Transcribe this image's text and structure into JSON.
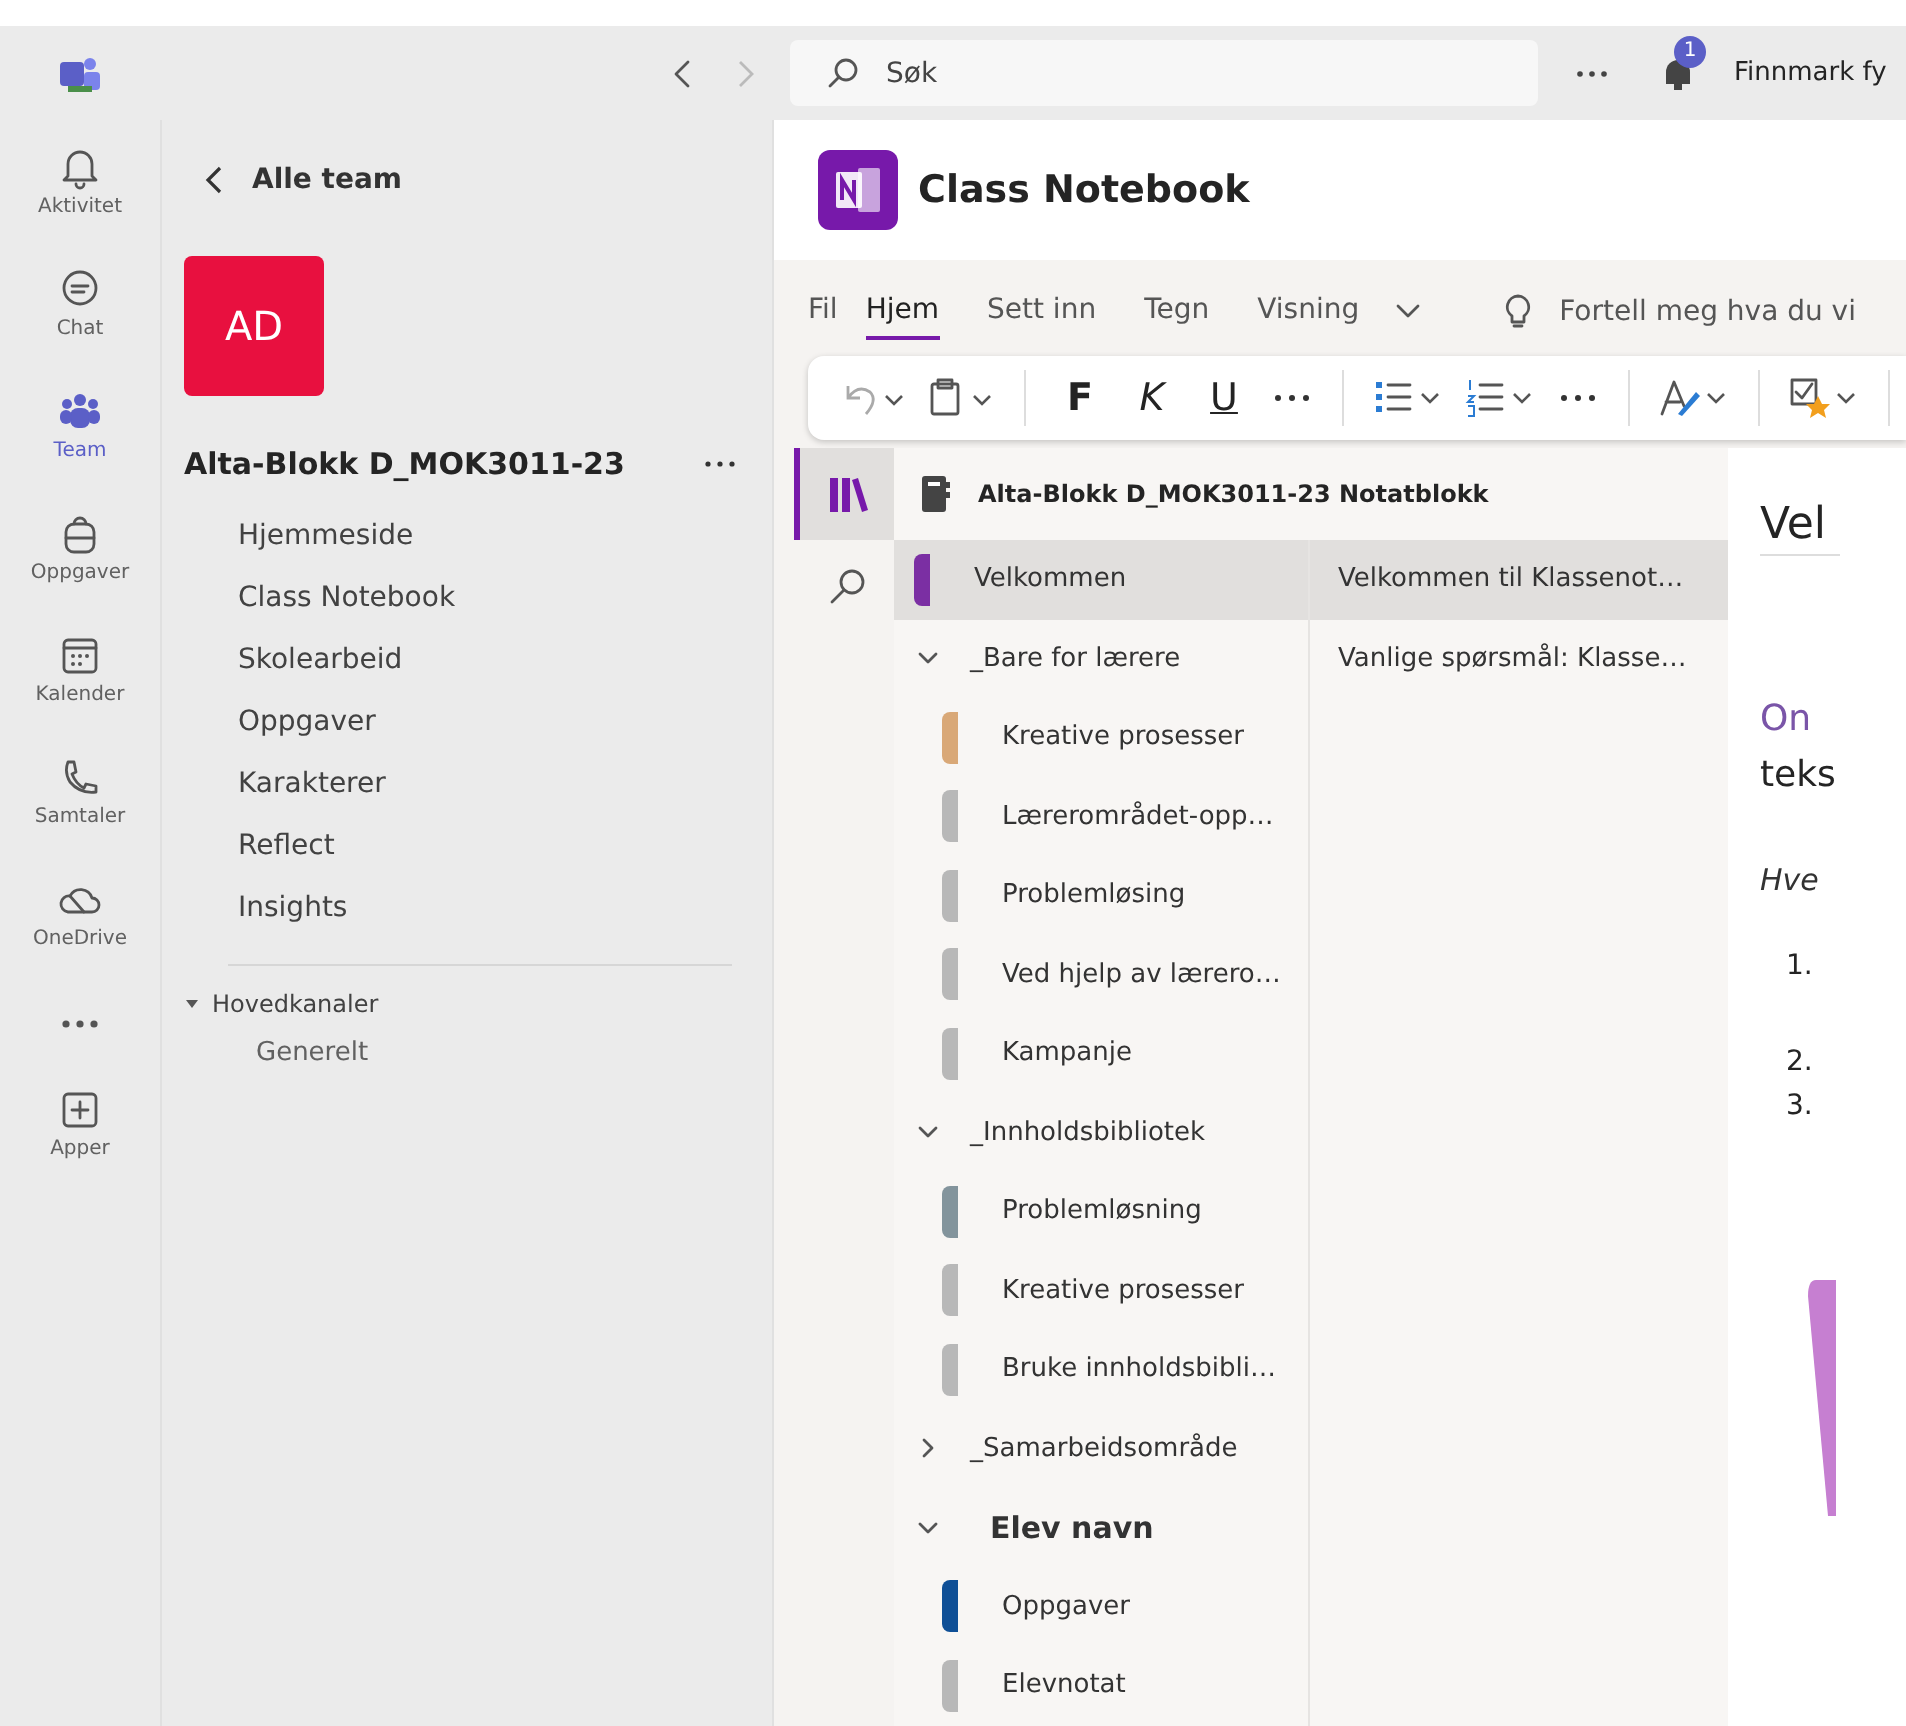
{
  "top_bar": {
    "search": {
      "placeholder": "Søk"
    },
    "notification_count": "1",
    "account": "Finnmark fy"
  },
  "rail": [
    {
      "kind": "bell",
      "label": "Aktivitet",
      "selected": false
    },
    {
      "kind": "chat",
      "label": "Chat",
      "selected": false
    },
    {
      "kind": "team",
      "label": "Team",
      "selected": true
    },
    {
      "kind": "bag",
      "label": "Oppgaver",
      "selected": false
    },
    {
      "kind": "calendar",
      "label": "Kalender",
      "selected": false
    },
    {
      "kind": "phone",
      "label": "Samtaler",
      "selected": false
    },
    {
      "kind": "cloud",
      "label": "OneDrive",
      "selected": false
    },
    {
      "kind": "more"
    },
    {
      "kind": "apps",
      "label": "Apper",
      "selected": false
    }
  ],
  "team_pane": {
    "back": "Alle team",
    "avatar": "AD",
    "name": "Alta-Blokk D_MOK3011-23",
    "tabs": [
      "Hjemmeside",
      "Class Notebook",
      "Skolearbeid",
      "Oppgaver",
      "Karakterer",
      "Reflect",
      "Insights"
    ],
    "channel_group": {
      "label": "Hovedkanaler",
      "expanded": true,
      "channels": [
        "Generelt"
      ]
    }
  },
  "notebook": {
    "title": "Class Notebook",
    "ribbon_tabs": [
      {
        "label": "Fil",
        "selected": false
      },
      {
        "label": "Hjem",
        "selected": true
      },
      {
        "label": "Sett inn",
        "selected": false
      },
      {
        "label": "Tegn",
        "selected": false
      },
      {
        "label": "Visning",
        "selected": false
      }
    ],
    "tell_me": "Fortell meg hva du vi",
    "toolbar": [
      {
        "kind": "undo"
      },
      {
        "kind": "paste"
      },
      {
        "kind": "sep"
      },
      {
        "kind": "letter",
        "label": "F"
      },
      {
        "kind": "letter",
        "label": "K"
      },
      {
        "kind": "letter",
        "label": "U"
      },
      {
        "kind": "more"
      },
      {
        "kind": "sep"
      },
      {
        "kind": "bullets"
      },
      {
        "kind": "numbering"
      },
      {
        "kind": "more"
      },
      {
        "kind": "sep"
      },
      {
        "kind": "styles"
      },
      {
        "kind": "sep"
      },
      {
        "kind": "tag"
      },
      {
        "kind": "sep"
      }
    ],
    "notebook_name": "Alta-Blokk D_MOK3011-23 Notatblokk",
    "sections": [
      {
        "kind": "section",
        "label": "Velkommen",
        "color": "#7b2fa3",
        "selected": true
      },
      {
        "kind": "group",
        "label": "_Bare for lærere",
        "expanded": true,
        "children": [
          {
            "kind": "section",
            "label": "Kreative prosesser",
            "color": "#d9a877",
            "selected": false
          },
          {
            "kind": "section",
            "label": "Lærerområdet-opp…",
            "color": "#b8b8b8",
            "selected": false
          },
          {
            "kind": "section",
            "label": "Problemløsing",
            "color": "#b8b8b8",
            "selected": false
          },
          {
            "kind": "section",
            "label": "Ved hjelp av lærero…",
            "color": "#b8b8b8",
            "selected": false
          },
          {
            "kind": "section",
            "label": "Kampanje",
            "color": "#b8b8b8",
            "selected": false
          }
        ]
      },
      {
        "kind": "group",
        "label": "_Innholdsbibliotek",
        "expanded": true,
        "children": [
          {
            "kind": "section",
            "label": "Problemløsning",
            "color": "#83949c",
            "selected": false
          },
          {
            "kind": "section",
            "label": "Kreative prosesser",
            "color": "#b8b8b8",
            "selected": false
          },
          {
            "kind": "section",
            "label": "Bruke innholdsbibli…",
            "color": "#b8b8b8",
            "selected": false
          }
        ]
      },
      {
        "kind": "group",
        "label": "_Samarbeidsområde",
        "expanded": false
      },
      {
        "kind": "student_group",
        "label": "Elev navn",
        "expanded": true,
        "children": [
          {
            "kind": "section",
            "label": "Oppgaver",
            "color": "#0f4f96",
            "selected": false
          },
          {
            "kind": "section",
            "label": "Elevnotat",
            "color": "#b8b8b8",
            "selected": false
          }
        ]
      }
    ],
    "pages": [
      {
        "title": "Velkommen til Klassenot…",
        "selected": true
      },
      {
        "title": "Vanlige spørsmål: Klasse…",
        "selected": false
      }
    ],
    "page": {
      "title": "Vel",
      "lines": [
        {
          "kind": "accent",
          "text": "On"
        },
        {
          "kind": "plain",
          "text": "teks"
        },
        {
          "kind": "italic",
          "text": "Hve"
        }
      ],
      "numbers": [
        "1.",
        "2.",
        "3."
      ]
    }
  }
}
